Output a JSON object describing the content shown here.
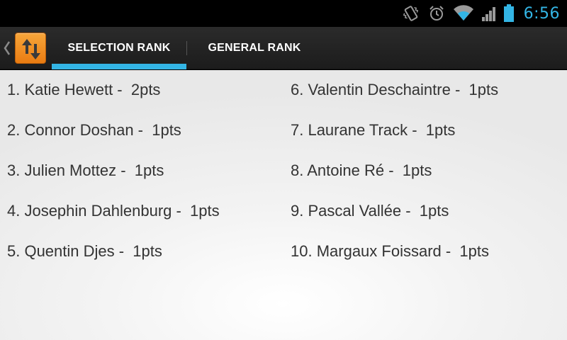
{
  "status_bar": {
    "time": "6:56",
    "icons": [
      "vibrate-icon",
      "alarm-icon",
      "wifi-icon",
      "signal-icon",
      "battery-icon"
    ],
    "accent_color": "#33b5e5"
  },
  "action_bar": {
    "app_icon": "up-down-arrows-icon",
    "tabs": [
      {
        "label": "SELECTION RANK",
        "selected": true
      },
      {
        "label": "GENERAL RANK",
        "selected": false
      }
    ]
  },
  "ranking": {
    "left": [
      {
        "text": "1. Katie Hewett -  2pts"
      },
      {
        "text": "2. Connor Doshan -  1pts"
      },
      {
        "text": "3. Julien Mottez -  1pts"
      },
      {
        "text": "4. Josephin Dahlenburg -  1pts"
      },
      {
        "text": "5. Quentin Djes -  1pts"
      }
    ],
    "right": [
      {
        "text": "6. Valentin Deschaintre -  1pts"
      },
      {
        "text": "7. Laurane Track -  1pts"
      },
      {
        "text": "8. Antoine Ré -  1pts"
      },
      {
        "text": "9. Pascal Vallée -  1pts"
      },
      {
        "text": "10. Margaux Foissard -  1pts"
      }
    ]
  }
}
